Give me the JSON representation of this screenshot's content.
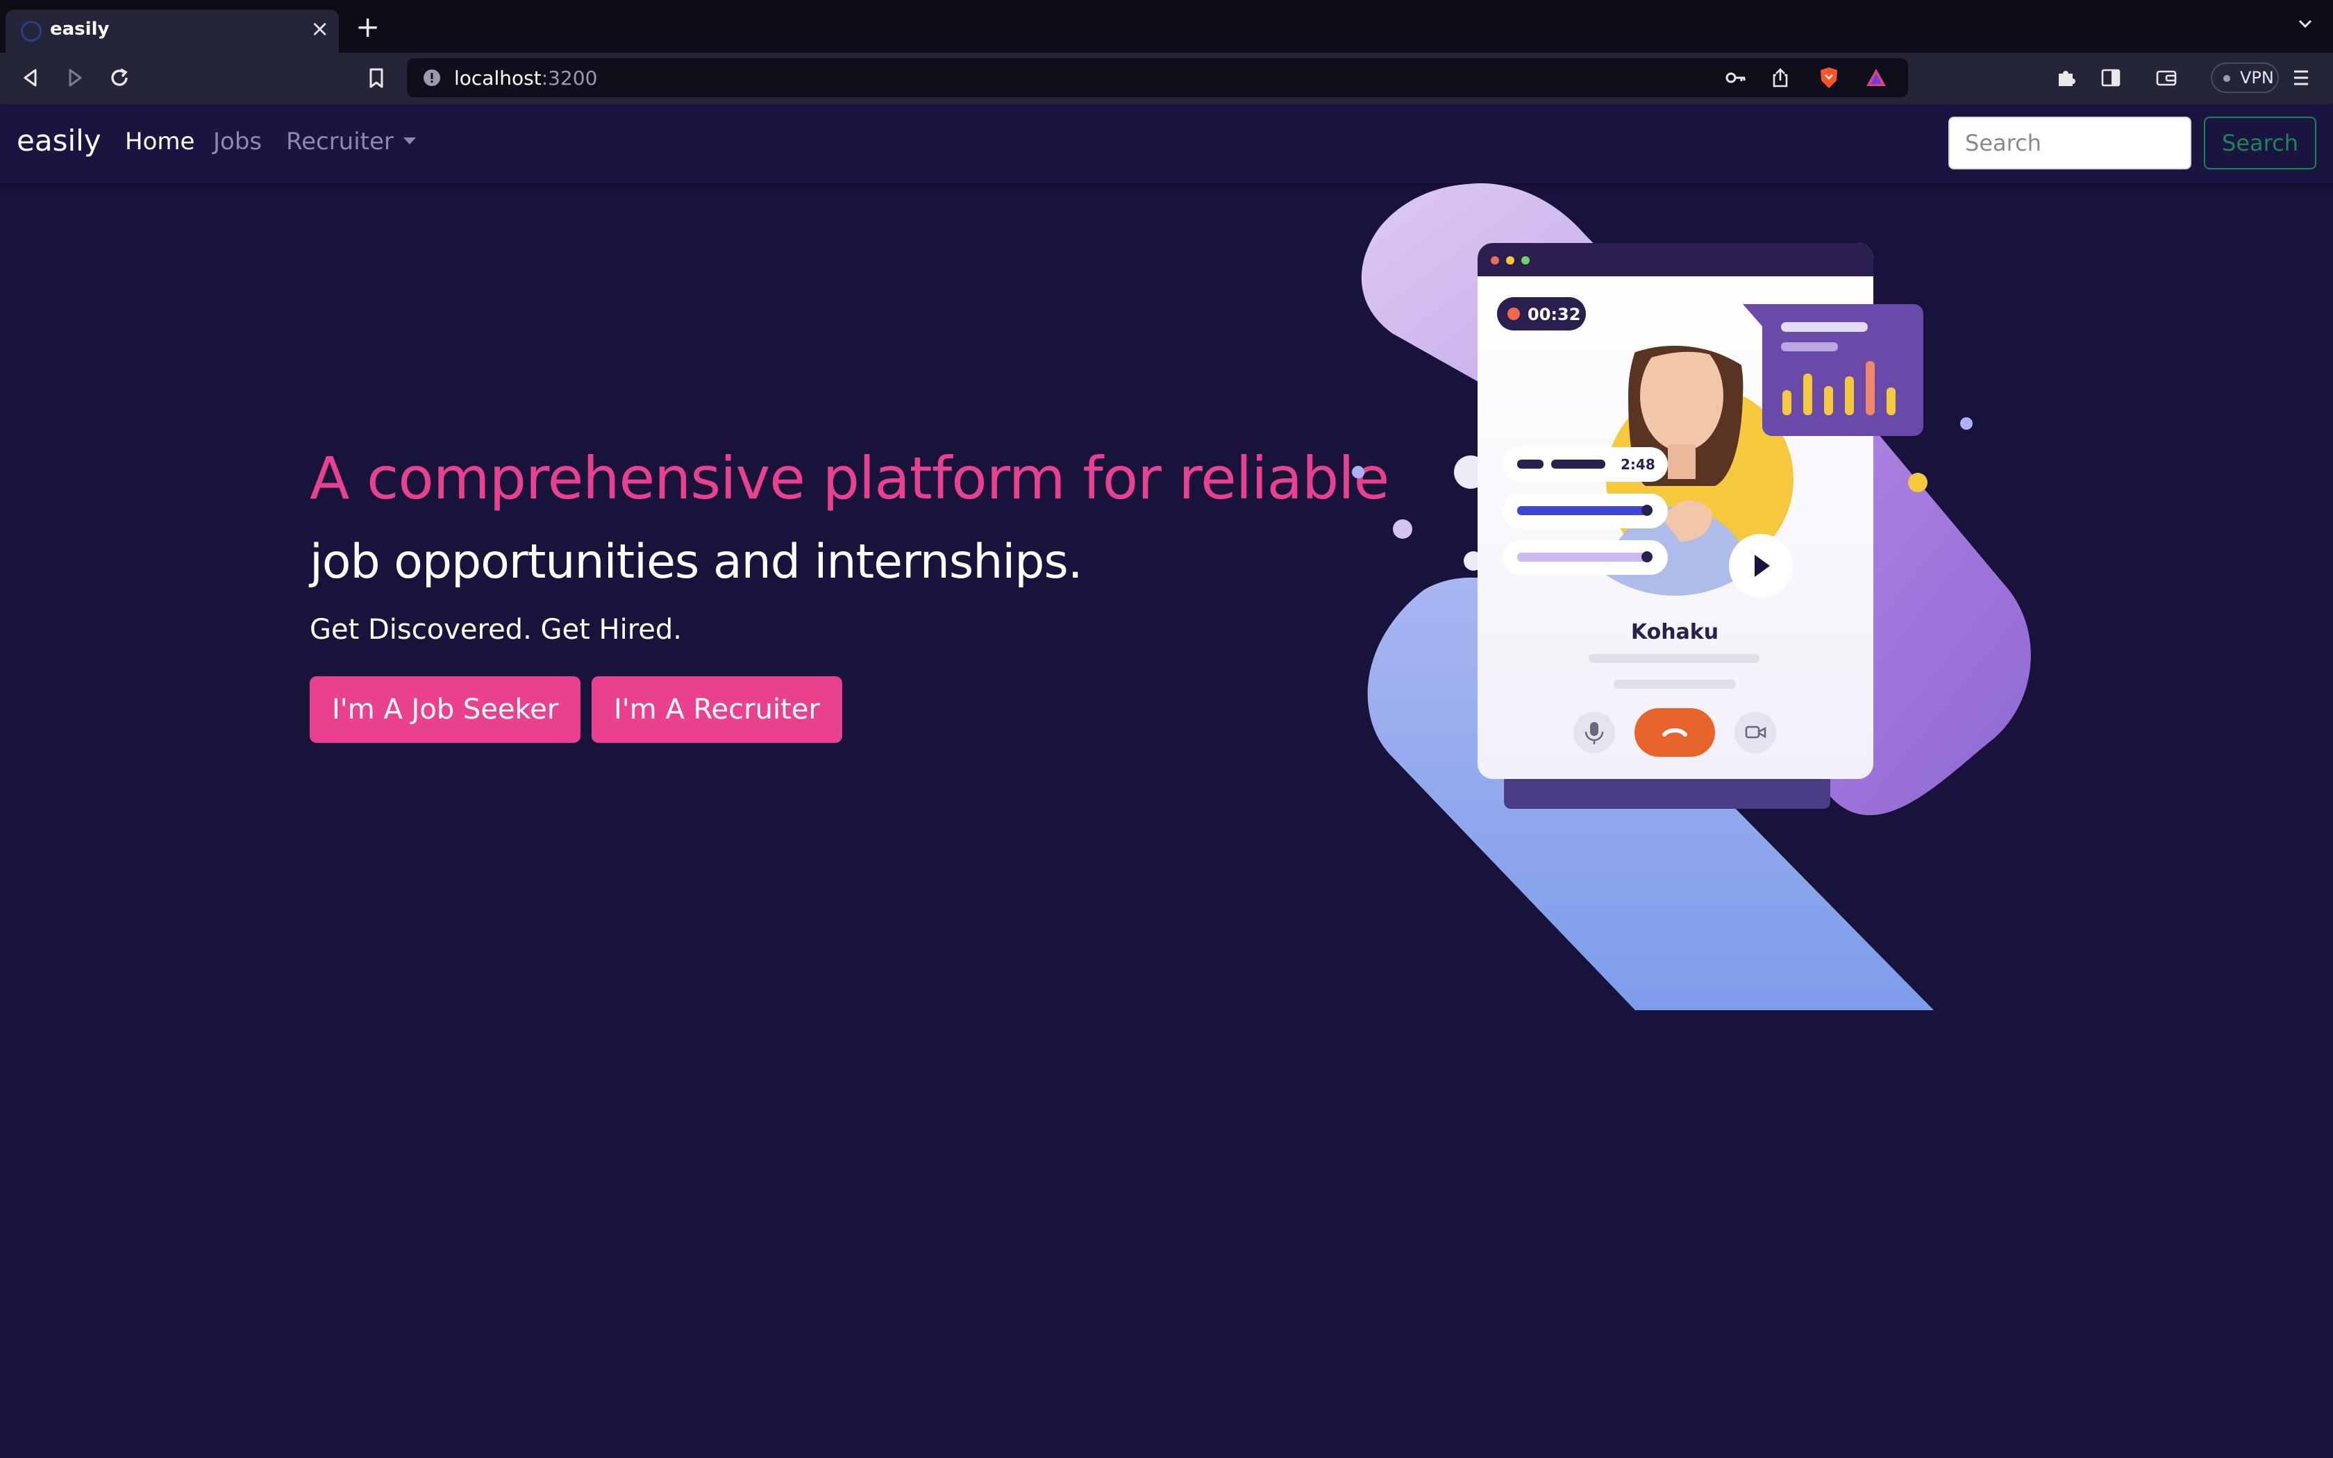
{
  "browser": {
    "tab_title": "easily",
    "address_host": "localhost",
    "address_port": ":3200",
    "vpn_label": "VPN"
  },
  "navbar": {
    "brand": "easily",
    "links": [
      {
        "label": "Home",
        "active": true
      },
      {
        "label": "Jobs",
        "active": false
      },
      {
        "label": "Recruiter",
        "active": false,
        "dropdown": true
      }
    ],
    "search_placeholder": "Search",
    "search_button": "Search"
  },
  "hero": {
    "headline": "A comprehensive platform for reliable",
    "subheadline": "job opportunities and internships.",
    "tagline": "Get Discovered. Get Hired.",
    "buttons": {
      "job_seeker": "I'm A Job Seeker",
      "recruiter": "I'm A Recruiter"
    }
  },
  "illustration": {
    "timer": "00:32",
    "duration": "2:48",
    "caller_name": "Kohaku"
  },
  "colors": {
    "page_bg": "#17133b",
    "accent": "#e94190",
    "search_outline": "#198754",
    "end_call": "#e8622c"
  }
}
